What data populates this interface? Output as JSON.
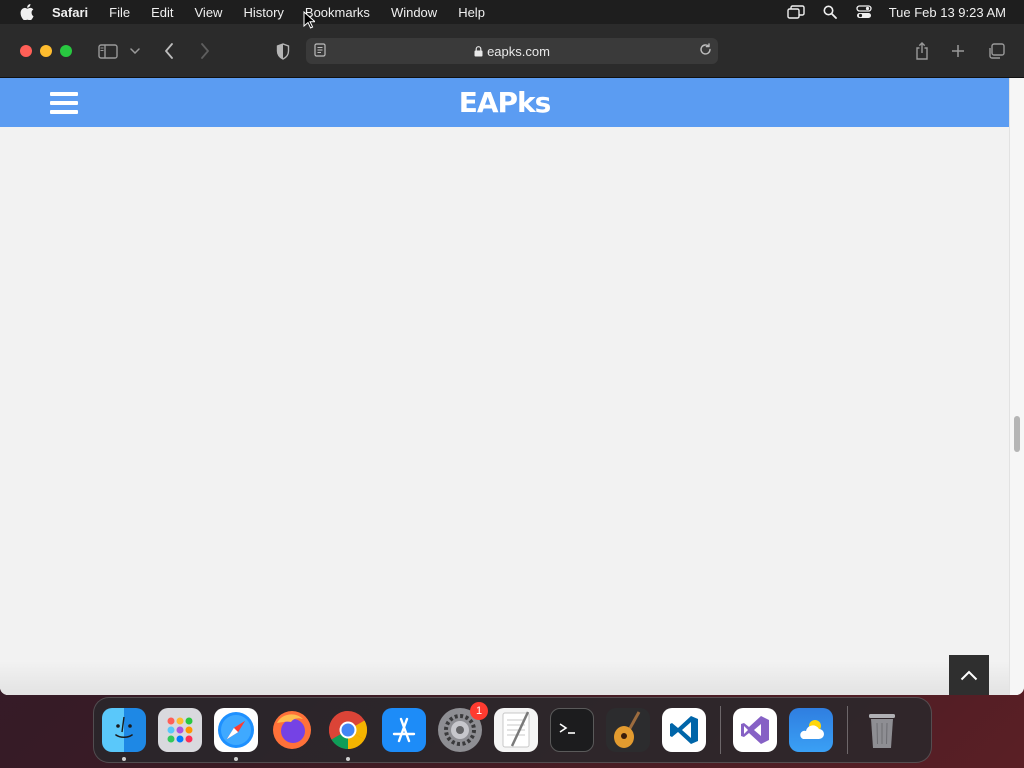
{
  "menubar": {
    "app_name": "Safari",
    "items": [
      "File",
      "Edit",
      "View",
      "History",
      "Bookmarks",
      "Window",
      "Help"
    ],
    "clock": "Tue Feb 13  9:23 AM"
  },
  "browser": {
    "url": "eapks.com"
  },
  "site": {
    "logo": "EAPks",
    "header_color": "#5b9cf2"
  },
  "dock": {
    "apps": [
      {
        "name": "Finder",
        "icon": "finder-icon",
        "running": true
      },
      {
        "name": "Launchpad",
        "icon": "launchpad-icon",
        "running": false
      },
      {
        "name": "Safari",
        "icon": "safari-icon",
        "running": true
      },
      {
        "name": "Firefox",
        "icon": "firefox-icon",
        "running": false
      },
      {
        "name": "Chrome",
        "icon": "chrome-icon",
        "running": true
      },
      {
        "name": "App Store",
        "icon": "app-store-icon",
        "running": false
      },
      {
        "name": "System Settings",
        "icon": "system-settings-icon",
        "running": false,
        "badge": "1"
      },
      {
        "name": "TextEdit",
        "icon": "textedit-icon",
        "running": false
      },
      {
        "name": "Terminal",
        "icon": "terminal-icon",
        "running": false
      },
      {
        "name": "GarageBand",
        "icon": "garageband-icon",
        "running": false
      },
      {
        "name": "Visual Studio Code",
        "icon": "vscode-icon",
        "running": false
      },
      {
        "name": "Visual Studio",
        "icon": "visual-studio-icon",
        "running": false
      },
      {
        "name": "Weather",
        "icon": "weather-icon",
        "running": false
      },
      {
        "name": "Trash",
        "icon": "trash-icon",
        "running": false
      }
    ],
    "badge_text": "1"
  }
}
